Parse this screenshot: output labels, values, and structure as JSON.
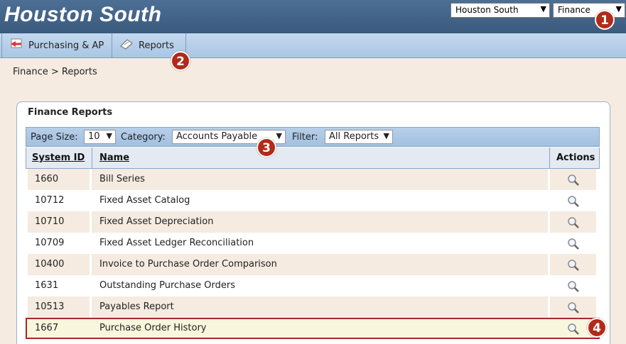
{
  "header": {
    "title": "Houston South",
    "campus_select": "Houston South",
    "module_select": "Finance"
  },
  "nav": {
    "items": [
      {
        "label": "Purchasing & AP",
        "icon": "purchasing-icon"
      },
      {
        "label": "Reports",
        "icon": "reports-icon"
      }
    ]
  },
  "breadcrumb": "Finance > Reports",
  "panel": {
    "title": "Finance Reports",
    "filters": {
      "page_size_label": "Page Size:",
      "page_size": "10",
      "category_label": "Category:",
      "category": "Accounts Payable",
      "filter_label": "Filter:",
      "filter": "All Reports"
    },
    "columns": {
      "id": "System ID",
      "name": "Name",
      "actions": "Actions"
    },
    "rows": [
      {
        "id": "1660",
        "name": "Bill Series"
      },
      {
        "id": "10712",
        "name": "Fixed Asset Catalog"
      },
      {
        "id": "10710",
        "name": "Fixed Asset Depreciation"
      },
      {
        "id": "10709",
        "name": "Fixed Asset Ledger Reconciliation"
      },
      {
        "id": "10400",
        "name": "Invoice to Purchase Order Comparison"
      },
      {
        "id": "1631",
        "name": "Outstanding Purchase Orders"
      },
      {
        "id": "10513",
        "name": "Payables Report"
      },
      {
        "id": "1667",
        "name": "Purchase Order History"
      }
    ]
  },
  "callouts": [
    "1",
    "2",
    "3",
    "4"
  ],
  "colors": {
    "accent": "#3a5a7e",
    "callout": "#b22a18",
    "row_alt": "#f5ebe0",
    "highlight_border": "#a52a2a"
  }
}
